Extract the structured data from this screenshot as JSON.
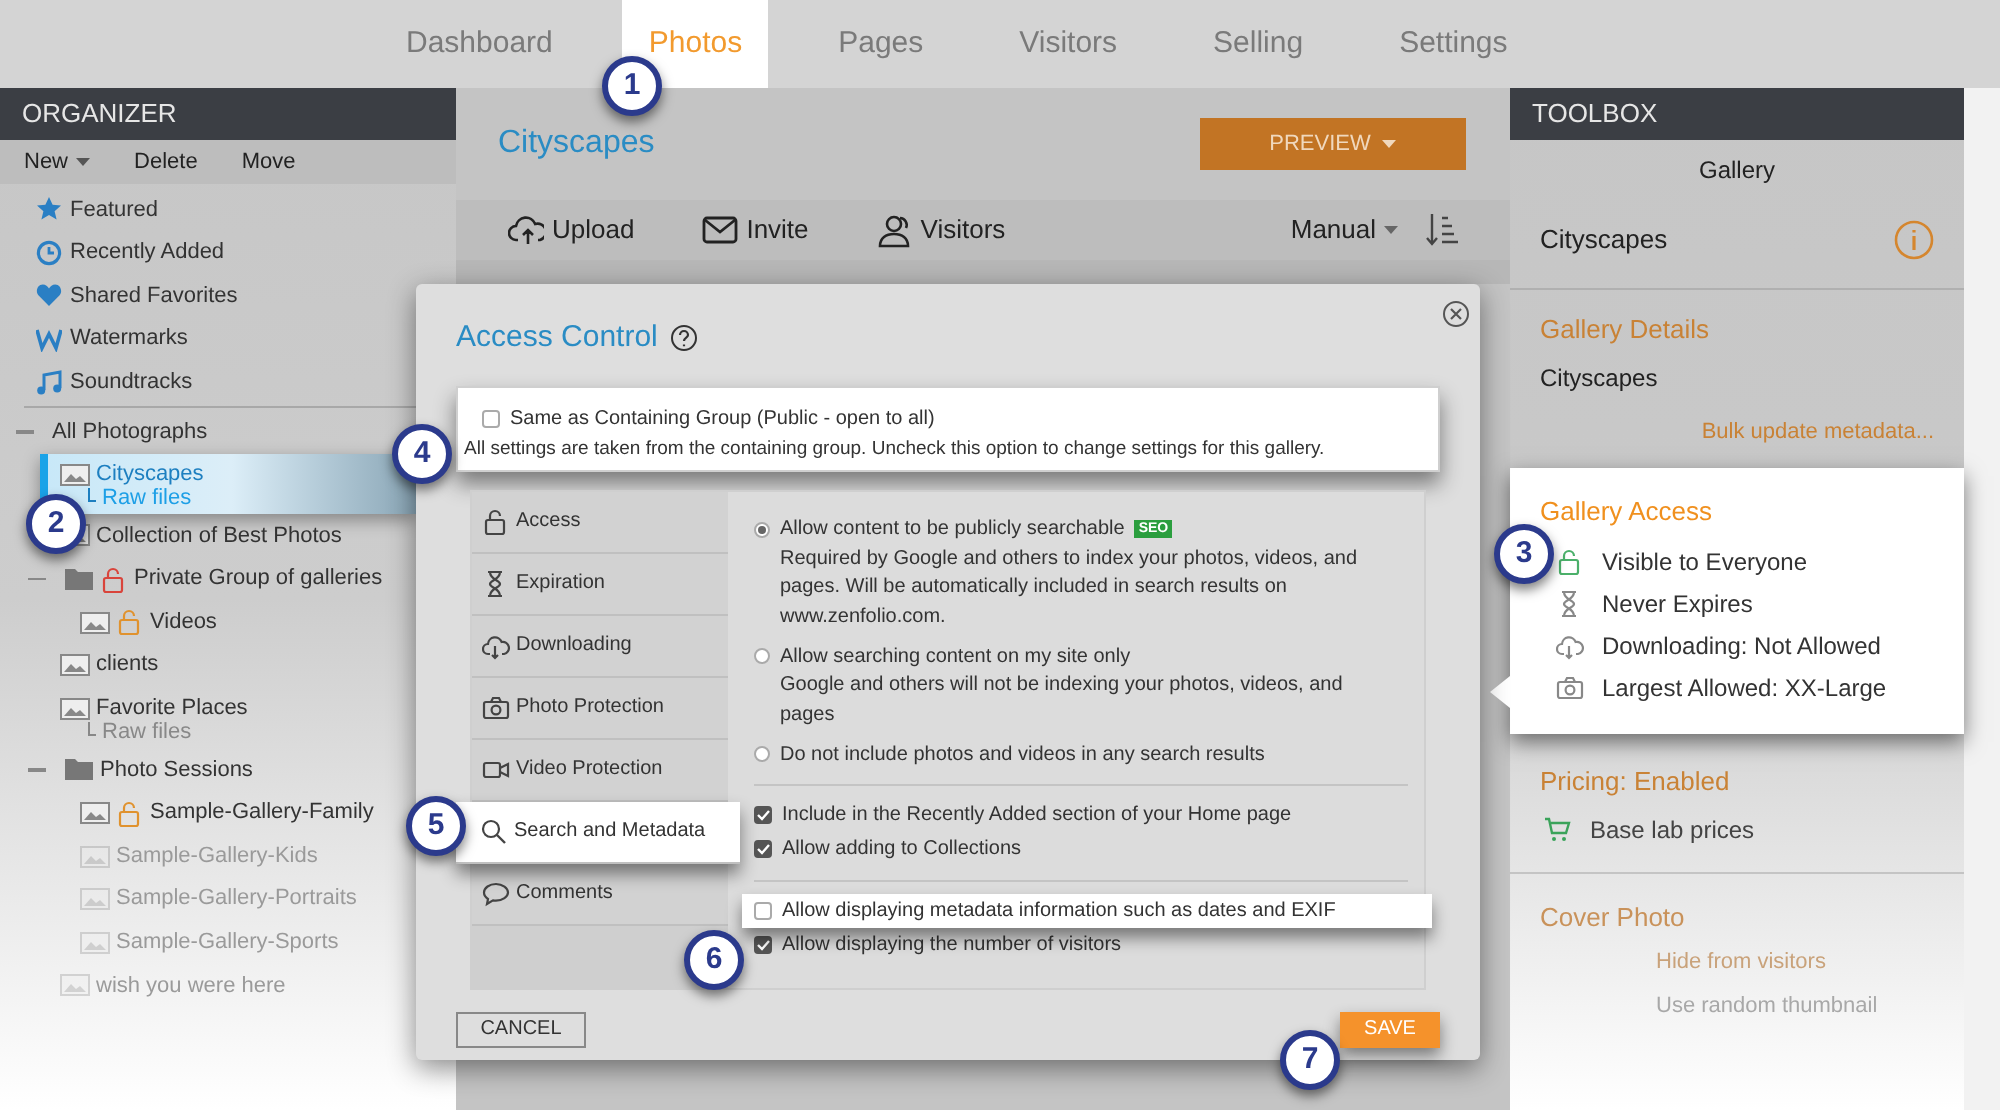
{
  "top_nav": {
    "tabs": [
      {
        "label": "Dashboard",
        "selected": false
      },
      {
        "label": "Photos",
        "selected": true
      },
      {
        "label": "Pages",
        "selected": false
      },
      {
        "label": "Visitors",
        "selected": false
      },
      {
        "label": "Selling",
        "selected": false
      },
      {
        "label": "Settings",
        "selected": false
      }
    ]
  },
  "organizer": {
    "title": "ORGANIZER",
    "actions": [
      {
        "label": "New",
        "dropdown": true
      },
      {
        "label": "Delete",
        "dropdown": false
      },
      {
        "label": "Move",
        "dropdown": false
      }
    ],
    "special_items": [
      "Featured",
      "Recently Added",
      "Shared Favorites",
      "Watermarks",
      "Soundtracks"
    ],
    "tree": [
      {
        "label": "All Photographs",
        "expanded": true,
        "selected": false,
        "faded": false,
        "children": [
          {
            "label": "Cityscapes",
            "kind": "gallery",
            "selected": true,
            "faded": false,
            "sub": "Raw files"
          },
          {
            "label": "Collection of Best Photos",
            "kind": "gallery",
            "selected": false,
            "faded": false
          },
          {
            "label": "Private Group of galleries",
            "kind": "folder",
            "expanded": true,
            "selected": false,
            "faded": false,
            "lock": {
              "color": "#d9443b"
            },
            "children": [
              {
                "label": "Videos",
                "kind": "gallery",
                "selected": false,
                "faded": false,
                "lock": {
                  "color": "#e0922e"
                }
              }
            ]
          },
          {
            "label": "clients",
            "kind": "gallery",
            "selected": false,
            "faded": false
          },
          {
            "label": "Favorite Places",
            "kind": "gallery",
            "selected": false,
            "faded": false,
            "sub": "Raw files"
          },
          {
            "label": "Photo Sessions",
            "kind": "folder",
            "expanded": true,
            "selected": false,
            "faded": false,
            "children": [
              {
                "label": "Sample-Gallery-Family",
                "kind": "gallery",
                "selected": false,
                "faded": false,
                "lock": {
                  "color": "#e0922e"
                }
              },
              {
                "label": "Sample-Gallery-Kids",
                "kind": "gallery",
                "selected": false,
                "faded": true
              },
              {
                "label": "Sample-Gallery-Portraits",
                "kind": "gallery",
                "selected": false,
                "faded": true
              },
              {
                "label": "Sample-Gallery-Sports",
                "kind": "gallery",
                "selected": false,
                "faded": true
              }
            ]
          },
          {
            "label": "wish you were here",
            "kind": "gallery",
            "selected": false,
            "faded": true
          }
        ]
      }
    ]
  },
  "gallery": {
    "title": "Cityscapes",
    "preview_button": "PREVIEW",
    "toolbar": [
      "Upload",
      "Invite",
      "Visitors"
    ],
    "sort": "Manual"
  },
  "toolbox": {
    "title": "TOOLBOX",
    "heading": "Gallery",
    "name": "Cityscapes",
    "details": {
      "title": "Gallery Details",
      "value": "Cityscapes",
      "link": "Bulk update metadata..."
    },
    "access": {
      "title": "Gallery Access",
      "highlighted": true,
      "items": [
        "Visible to Everyone",
        "Never Expires",
        "Downloading: Not Allowed",
        "Largest Allowed: XX-Large"
      ]
    },
    "pricing": {
      "title": "Pricing: Enabled",
      "items": [
        "Base lab prices"
      ]
    },
    "cover": {
      "title": "Cover Photo",
      "options": [
        "Hide from visitors",
        "Use random thumbnail"
      ]
    }
  },
  "modal": {
    "title": "Access Control",
    "inherit": {
      "label": "Same as Containing Group (Public - open to all)",
      "checked": false,
      "highlighted": true,
      "note": "All settings are taken from the containing group. Uncheck this option to change settings for this gallery."
    },
    "tabs": [
      {
        "label": "Access",
        "selected": false
      },
      {
        "label": "Expiration",
        "selected": false
      },
      {
        "label": "Downloading",
        "selected": false
      },
      {
        "label": "Photo Protection",
        "selected": false
      },
      {
        "label": "Video Protection",
        "selected": false
      },
      {
        "label": "Search and Metadata",
        "selected": true
      },
      {
        "label": "Comments",
        "selected": false
      }
    ],
    "search_options": [
      {
        "label": "Allow content to be publicly searchable",
        "badge": "SEO",
        "selected": true,
        "description": "Required by Google and others to index your photos, videos, and pages. Will be automatically included in search results on www.zenfolio.com."
      },
      {
        "label": "Allow searching content on my site only",
        "selected": false,
        "description": "Google and others will not be indexing your photos, videos, and pages"
      },
      {
        "label": "Do not include photos and videos in any search results",
        "selected": false
      }
    ],
    "checkbox_groups": [
      [
        {
          "label": "Include in the Recently Added section of your Home page",
          "checked": true,
          "highlighted": false
        },
        {
          "label": "Allow adding to Collections",
          "checked": true,
          "highlighted": false
        }
      ],
      [
        {
          "label": "Allow displaying metadata information such as dates and EXIF",
          "checked": false,
          "highlighted": true
        },
        {
          "label": "Allow displaying the number of visitors",
          "checked": true,
          "highlighted": false
        }
      ]
    ],
    "cancel_button": "CANCEL",
    "save_button": "SAVE"
  },
  "callouts": [
    "1",
    "2",
    "3",
    "4",
    "5",
    "6",
    "7"
  ]
}
